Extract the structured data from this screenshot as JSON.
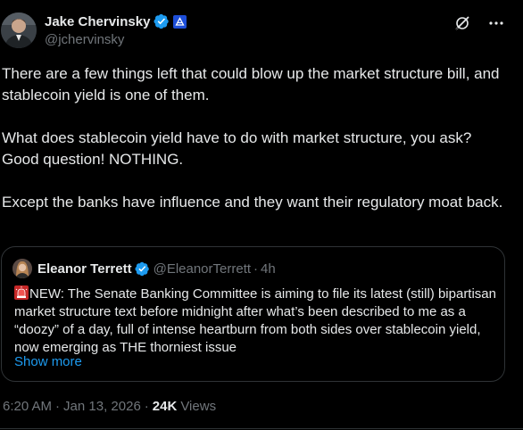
{
  "author": {
    "display_name": "Jake Chervinsky",
    "handle": "@jchervinsky",
    "avatar_icon": "person-avatar",
    "verified_icon": "verified-badge-icon",
    "affiliation_icon": "affiliate-badge-icon"
  },
  "actions": {
    "grok_icon": "grok-icon",
    "more_icon": "more-icon"
  },
  "tweet": {
    "paragraphs": [
      "There are a few things left that could blow up the market structure bill, and stablecoin yield is one of them.",
      "What does stablecoin yield have to do with market structure, you ask? Good question! NOTHING.",
      "Except the banks have influence and they want their regulatory moat back."
    ]
  },
  "quote": {
    "display_name": "Eleanor Terrett",
    "handle": "@EleanorTerrett",
    "separator": "·",
    "time": "4h",
    "text": "NEW: The Senate Banking Committee is aiming to file its latest (still) bipartisan market structure text before midnight after what’s been described to me as a “doozy” of a day, full of intense heartburn from both sides over stablecoin yield, now emerging as THE thorniest issue",
    "alarm_icon": "alarm-light-icon",
    "show_more": "Show more"
  },
  "meta": {
    "time": "6:20 AM",
    "separator": "·",
    "date": "Jan 13, 2026",
    "separator2": "·",
    "views_count": "24K",
    "views_label": "Views"
  },
  "colors": {
    "background": "#000000",
    "text": "#e7e9ea",
    "muted": "#71767b",
    "accent": "#1d9bf0",
    "border": "#2f3336"
  }
}
